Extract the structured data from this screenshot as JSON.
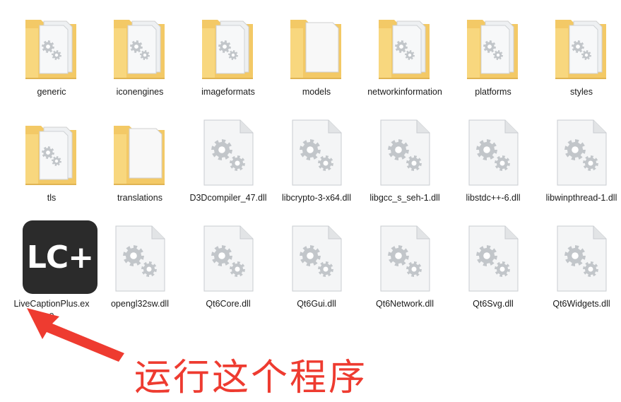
{
  "items": [
    {
      "name": "generic",
      "type": "folder"
    },
    {
      "name": "iconengines",
      "type": "folder"
    },
    {
      "name": "imageformats",
      "type": "folder"
    },
    {
      "name": "models",
      "type": "folder"
    },
    {
      "name": "networkinformation",
      "type": "folder"
    },
    {
      "name": "platforms",
      "type": "folder"
    },
    {
      "name": "styles",
      "type": "folder"
    },
    {
      "name": "tls",
      "type": "folder"
    },
    {
      "name": "translations",
      "type": "folder"
    },
    {
      "name": "D3Dcompiler_47.dll",
      "type": "dll"
    },
    {
      "name": "libcrypto-3-x64.dll",
      "type": "dll"
    },
    {
      "name": "libgcc_s_seh-1.dll",
      "type": "dll"
    },
    {
      "name": "libstdc++-6.dll",
      "type": "dll"
    },
    {
      "name": "libwinpthread-1.dll",
      "type": "dll"
    },
    {
      "name": "LiveCaptionPlus.exe",
      "type": "exe",
      "icon_text": "LC+"
    },
    {
      "name": "opengl32sw.dll",
      "type": "dll"
    },
    {
      "name": "Qt6Core.dll",
      "type": "dll"
    },
    {
      "name": "Qt6Gui.dll",
      "type": "dll"
    },
    {
      "name": "Qt6Network.dll",
      "type": "dll"
    },
    {
      "name": "Qt6Svg.dll",
      "type": "dll"
    },
    {
      "name": "Qt6Widgets.dll",
      "type": "dll"
    }
  ],
  "annotation": {
    "text": "运行这个程序"
  },
  "colors": {
    "folder": "#f3c966",
    "folder_front": "#f8d77e",
    "file_bg": "#f4f5f6",
    "gear": "#c2c6ca",
    "app_tile": "#2b2b2b",
    "arrow": "#ee3b30"
  }
}
